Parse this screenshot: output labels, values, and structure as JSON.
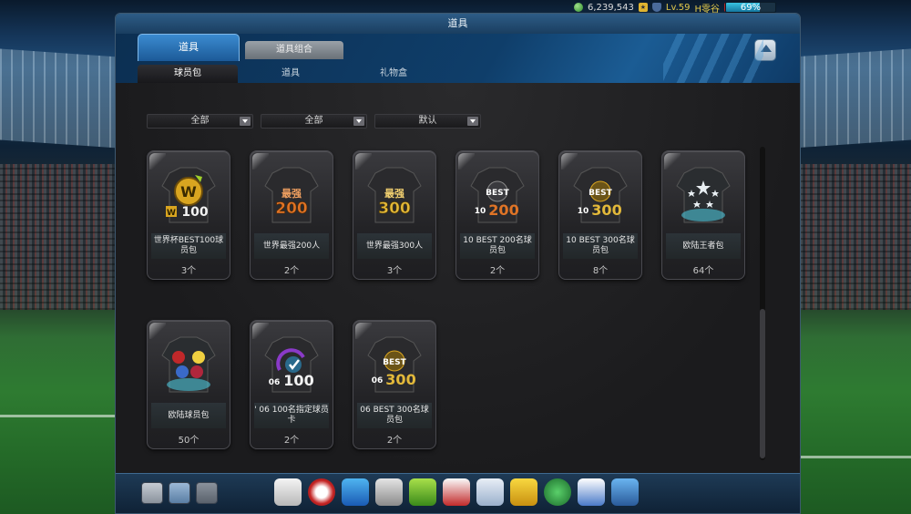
{
  "status": {
    "currency": "6,239,543",
    "level": "Lv.59",
    "player_name": "H零谷",
    "percent_label": "69%",
    "percent_value": 69
  },
  "window": {
    "title": "道具"
  },
  "tabs": {
    "main": "道具",
    "secondary": "道具组合"
  },
  "subtabs": [
    "球员包",
    "道具",
    "礼物盒"
  ],
  "filters": [
    "全部",
    "全部",
    "默认"
  ],
  "cards": [
    {
      "name": "世界杯BEST100球员包",
      "count": "3个",
      "icon": "wc100-icon"
    },
    {
      "name": "世界最强200人",
      "count": "2个",
      "icon": "strongest200-icon"
    },
    {
      "name": "世界最强300人",
      "count": "3个",
      "icon": "strongest300-icon"
    },
    {
      "name": "10 BEST 200名球员包",
      "count": "2个",
      "icon": "best10-200-icon"
    },
    {
      "name": "10 BEST 300名球员包",
      "count": "8个",
      "icon": "best10-300-icon"
    },
    {
      "name": "欧陆王者包",
      "count": "64个",
      "icon": "ucl-kings-icon"
    },
    {
      "name": "欧陆球员包",
      "count": "50个",
      "icon": "euro-players-icon"
    },
    {
      "name": "' 06 100名指定球员卡",
      "count": "2个",
      "icon": "06-100-icon"
    },
    {
      "name": "06 BEST 300名球员包",
      "count": "2个",
      "icon": "best06-300-icon"
    }
  ],
  "art_labels": {
    "wc": "100",
    "s200_top": "最强",
    "s200_num": "200",
    "s300_top": "最强",
    "s300_num": "300",
    "b200_top": "BEST",
    "b200_pre": "10",
    "b200_num": "200",
    "b300_top": "BEST",
    "b300_pre": "10",
    "b300_num": "300",
    "c06_pre": "06",
    "c06_num": "100",
    "b06_top": "BEST",
    "b06_pre": "06",
    "b06_num": "300"
  },
  "footer_icons": [
    "contacts-icon",
    "chat-icon",
    "mail-icon",
    "whistle-icon",
    "ball-icon",
    "boot-icon",
    "trophy-icon",
    "formation-icon",
    "jersey-icon",
    "notepad-icon",
    "gold-jersey-icon",
    "club-icon",
    "card-icon",
    "cart-icon"
  ],
  "colors": {
    "accent": "#2f6ea6",
    "panel": "#1d1d1f",
    "gold": "#e3b93a",
    "orange": "#e07426"
  }
}
